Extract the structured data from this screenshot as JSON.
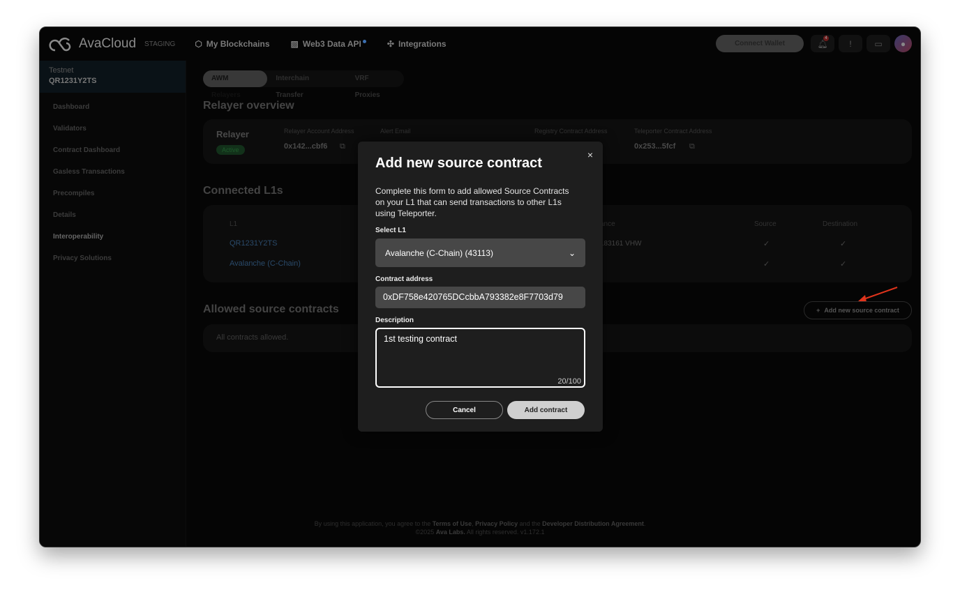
{
  "app": {
    "logo": "AvaCloud",
    "env": "STAGING"
  },
  "nav": [
    {
      "label": "My Blockchains",
      "icon": "cube-icon"
    },
    {
      "label": "Web3 Data API",
      "icon": "chart-icon"
    },
    {
      "label": "Integrations",
      "icon": "puzzle-icon"
    }
  ],
  "header": {
    "connect_wallet": "Connect Wallet",
    "notifications": "4"
  },
  "sidebar": {
    "network": "Testnet",
    "chain": "QR1231Y2TS",
    "items": [
      "Dashboard",
      "Validators",
      "Contract Dashboard",
      "Gasless Transactions",
      "Precompiles",
      "Details",
      "Interoperability",
      "Privacy Solutions"
    ]
  },
  "tabs": [
    "AWM Relayers",
    "Interchain Transfer",
    "VRF Proxies"
  ],
  "overview": {
    "title": "Relayer overview",
    "relayer": "Relayer",
    "status": "Active",
    "account_label": "Relayer Account Address",
    "account": "0x142...cbf6",
    "alert_label": "Alert Email",
    "registry_label": "Registry Contract Address",
    "teleporter_label": "Teleporter Contract Address",
    "teleporter": "0x253...5fcf"
  },
  "connected": {
    "title": "Connected L1s",
    "headers": {
      "l1": "L1",
      "balance": "ance",
      "source": "Source",
      "destination": "Destination"
    },
    "rows": [
      {
        "name": "QR1231Y2TS",
        "balance": "183161 VHW"
      },
      {
        "name": "Avalanche (C-Chain)",
        "balance": ""
      }
    ],
    "check": "✓"
  },
  "allowed": {
    "title": "Allowed source contracts",
    "empty": "All contracts allowed.",
    "add_button": "Add new source contract"
  },
  "footer": {
    "p1": "By using this application, you agree to the ",
    "terms": "Terms of Use",
    "comma": ", ",
    "privacy": "Privacy Policy",
    "and": " and the ",
    "dda": "Developer Distribution Agreement",
    "end": ".",
    "copy": "©2025 ",
    "ava": "Ava Labs.",
    "rights": "  All rights reserved.  v1.172.1"
  },
  "modal": {
    "close": "×",
    "title": "Add new source contract",
    "description": "Complete this form to add allowed Source Contracts on your L1 that can send transactions to other L1s using Teleporter.",
    "select_label": "Select L1",
    "select_value": "Avalanche (C-Chain) (43113)",
    "address_label": "Contract address",
    "address_value": "0xDF758e420765DCcbbA793382e8F7703d79",
    "desc_label": "Description",
    "desc_value": "1st testing contract",
    "counter": "20/100",
    "cancel": "Cancel",
    "add": "Add contract"
  }
}
